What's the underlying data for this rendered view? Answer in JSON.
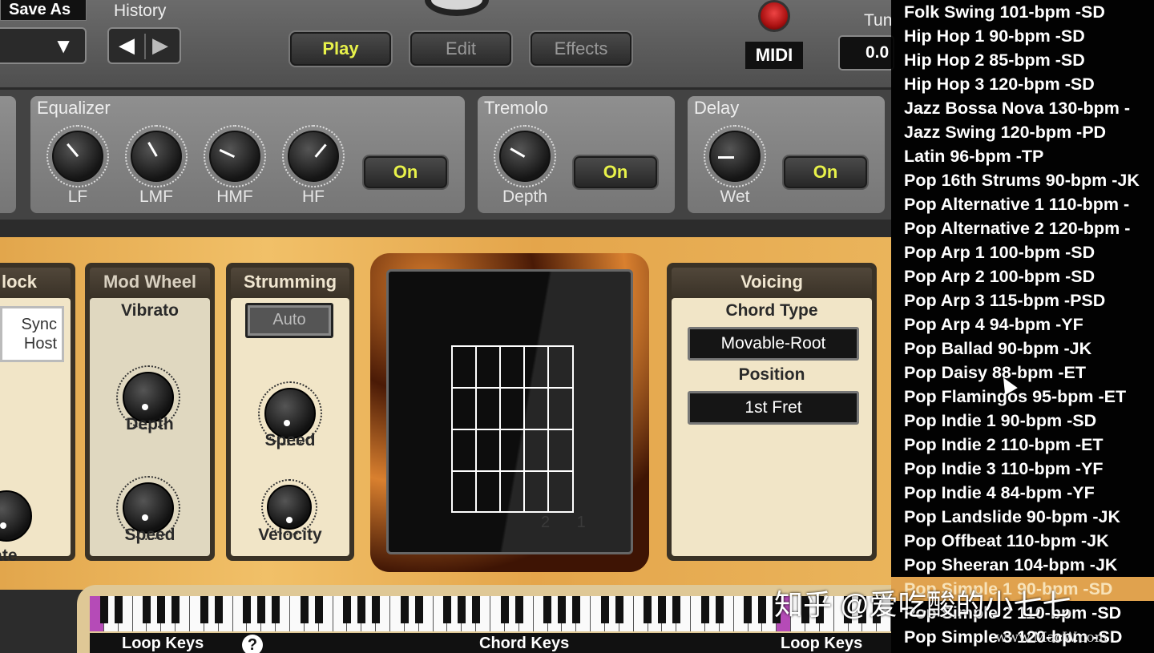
{
  "toolbar": {
    "save_as": "Save As",
    "history_label": "History",
    "history_back": "◀",
    "history_forward": "▶",
    "dropdown_arrow": "▼",
    "play": "Play",
    "edit": "Edit",
    "effects": "Effects",
    "midi": "MIDI",
    "tune_label": "Tun",
    "tune_value": "0.0"
  },
  "effects": {
    "equalizer": {
      "title": "Equalizer",
      "knobs": [
        "LF",
        "LMF",
        "HMF",
        "HF"
      ],
      "on": "On"
    },
    "tremolo": {
      "title": "Tremolo",
      "knob": "Depth",
      "on": "On"
    },
    "delay": {
      "title": "Delay",
      "knob": "Wet",
      "on": "On"
    }
  },
  "modules": {
    "clock": {
      "title": "lock",
      "sync": "Sync",
      "host": "Host",
      "rate": "Rate"
    },
    "mod_wheel": {
      "title": "Mod Wheel",
      "vibrato": "Vibrato",
      "depth": "Depth",
      "speed": "Speed"
    },
    "strumming": {
      "title": "Strumming",
      "auto": "Auto",
      "speed": "Speed",
      "velocity": "Velocity"
    },
    "voicing": {
      "title": "Voicing",
      "chord_type_label": "Chord Type",
      "chord_type_value": "Movable-Root",
      "position_label": "Position",
      "position_value": "1st Fret"
    },
    "fret_numbers": "2 1"
  },
  "keyboard": {
    "loop_keys_left": "Loop Keys",
    "help": "?",
    "chord_keys": "Chord Keys",
    "loop_keys_right": "Loop Keys"
  },
  "style_list": {
    "items": [
      "Folk Swing 101-bpm -SD",
      "Hip Hop 1 90-bpm -SD",
      "Hip Hop 2 85-bpm -SD",
      "Hip Hop 3 120-bpm -SD",
      "Jazz Bossa Nova 130-bpm -",
      "Jazz Swing 120-bpm -PD",
      "Latin 96-bpm -TP",
      "Pop 16th Strums 90-bpm -JK",
      "Pop Alternative 1 110-bpm -",
      "Pop Alternative 2 120-bpm -",
      "Pop Arp 1 100-bpm -SD",
      "Pop Arp 2 100-bpm -SD",
      "Pop Arp 3 115-bpm -PSD",
      "Pop Arp 4 94-bpm -YF",
      "Pop Ballad 90-bpm -JK",
      "Pop Daisy 88-bpm -ET",
      "Pop Flamingos 95-bpm -ET",
      "Pop Indie 1 90-bpm -SD",
      "Pop Indie 2 110-bpm -ET",
      "Pop Indie 3 110-bpm -YF",
      "Pop Indie 4 84-bpm -YF",
      "Pop Landslide 90-bpm -JK",
      "Pop Offbeat 110-bpm -JK",
      "Pop Sheeran 104-bpm -JK",
      "Pop Simple 1 90-bpm -SD",
      "Pop Simple 2 110-bpm -SD",
      "Pop Simple 3 120-bpm -SD"
    ],
    "selected_index": 24
  },
  "watermark": {
    "text": "知乎 @爱吃酸的小七七",
    "site": "www.MacW.com"
  },
  "colors": {
    "accent_yellow": "#e8f24a",
    "selection": "#e0a24e",
    "wood": "#f1c068"
  }
}
